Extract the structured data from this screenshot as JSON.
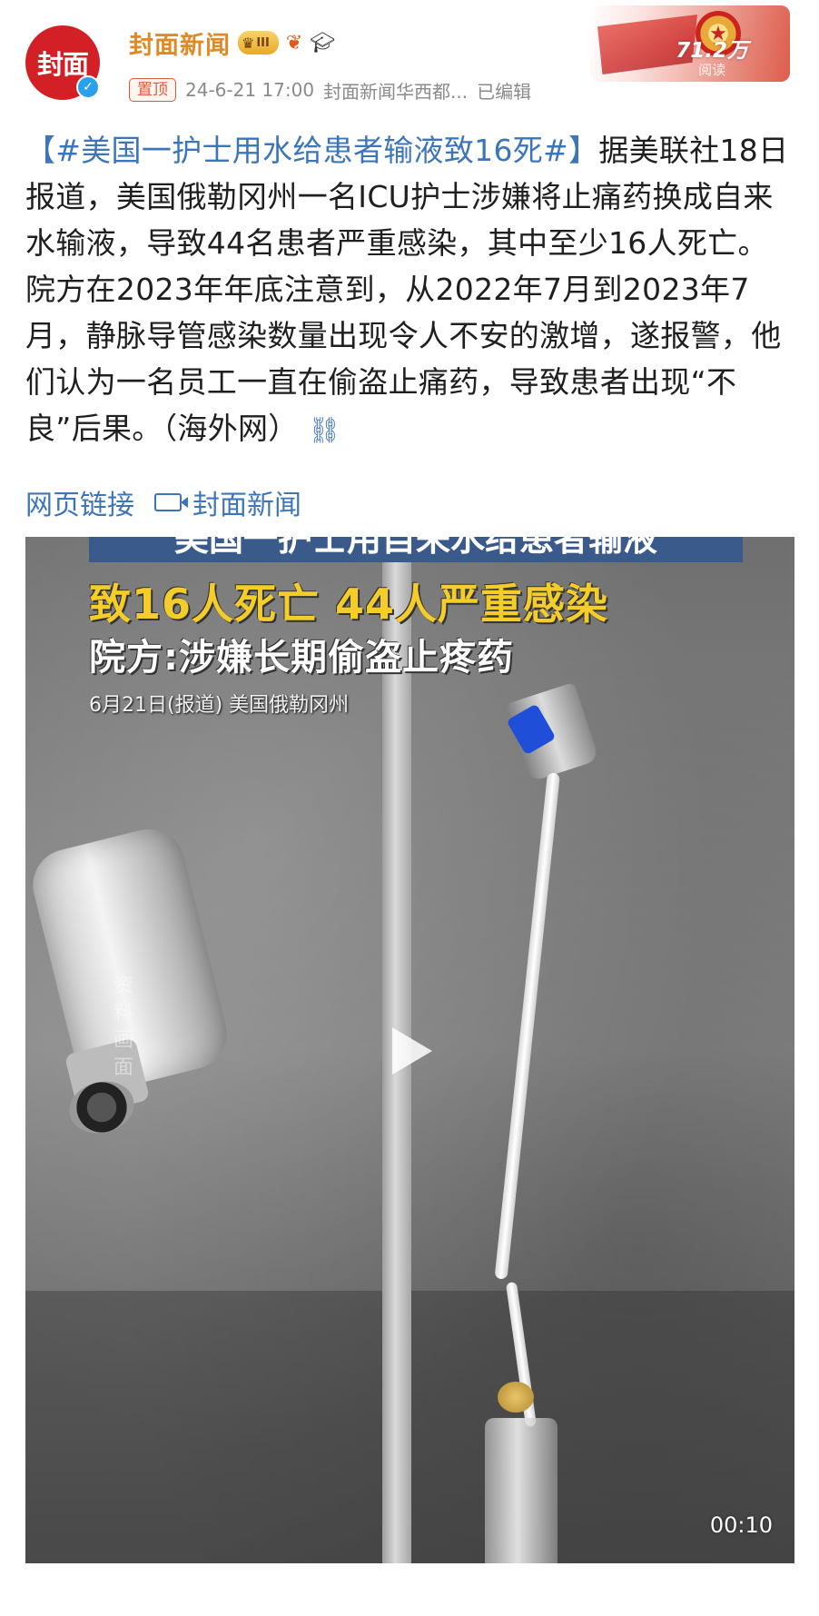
{
  "header": {
    "avatar_text": "封面",
    "account_name": "封面新闻",
    "level_badge": "III",
    "pinned_label": "置顶",
    "timestamp": "24-6-21 17:00",
    "source": "封面新闻华西都...",
    "edited": "已编辑",
    "views_count": "71.2万",
    "views_label": "阅读"
  },
  "post": {
    "hashtag": "【#美国一护士用水给患者输液致16死#】",
    "body": "据美联社18日报道，美国俄勒冈州一名ICU护士涉嫌将止痛药换成自来水输液，导致44名患者严重感染，其中至少16人死亡。院方在2023年年底注意到，从2022年7月到2023年7月，静脉导管感染数量出现令人不安的激增，遂报警，他们认为一名员工一直在偷盗止痛药，导致患者出现“不良”后果。（海外网）",
    "webpage_link": "网页链接",
    "video_source_link": "封面新闻"
  },
  "video": {
    "caption_line1": "美国一护士用自来水给患者输液",
    "caption_line2": "致16人死亡 44人严重感染",
    "caption_line3": "院方:涉嫌长期偷盗止疼药",
    "caption_date": "6月21日(报道) 美国俄勒冈州",
    "watermark": "资料画面",
    "duration": "00:10"
  },
  "colors": {
    "accent_orange": "#e08a26",
    "link_blue": "#3d76b8",
    "brand_red": "#d31f26",
    "caption_yellow": "#f4cd2b"
  },
  "icons": {
    "verified": "verified-icon",
    "link": "link-icon",
    "video": "video-icon",
    "play": "play-icon"
  }
}
